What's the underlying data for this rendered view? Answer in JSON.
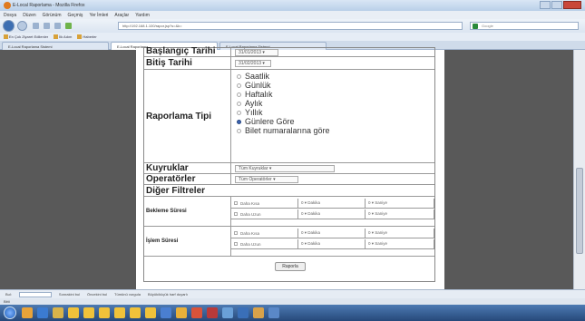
{
  "window": {
    "title": "E-Local Raporlama - Mozilla Firefox"
  },
  "menu": [
    "Dosya",
    "Düzen",
    "Görünüm",
    "Geçmiş",
    "Yer İmleri",
    "Araçlar",
    "Yardım"
  ],
  "nav": {
    "url": "http://192.168.1.100/rapor.jsp?s=&k=",
    "search_placeholder": "Google"
  },
  "bookmarks": [
    "En Çok Ziyaret Edilenler",
    "İlk Adım",
    "Haberler"
  ],
  "tabs": [
    "E-Local Raporlama Sistemi",
    "E-Local Raporlama",
    "E-Local Raporlama Sistemi"
  ],
  "form": {
    "baslangic_label": "Başlangıç Tarihi",
    "baslangic_value": "31/01/2013 ▾",
    "bitis_label": "Bitiş Tarihi",
    "bitis_value": "31/02/2013 ▾",
    "raporlama_label": "Raporlama Tipi",
    "raporlama_options": [
      "Saatlik",
      "Günlük",
      "Haftalık",
      "Aylık",
      "Yıllık",
      "Günlere Göre",
      "Bilet numaralarına göre"
    ],
    "raporlama_selected": 5,
    "kuyruklar_label": "Kuyruklar",
    "kuyruklar_value": "Tüm Kuyruklar                    ▾",
    "operatorler_label": "Operatörler",
    "operatorler_value": "Tüm Operatörler  ▾",
    "diger_label": "Diğer Filtreler",
    "bekleme_label": "Bekleme Süresi",
    "islem_label": "İşlem Süresi",
    "filter_rows": [
      {
        "check": "Daha Kısa",
        "dk": "0  ▾ Dakika",
        "sn": "0  ▾ Saniye"
      },
      {
        "check": "Daha Uzun",
        "dk": "0  ▾ Dakika",
        "sn": "0  ▾ Saniye"
      },
      {
        "check": "Daha Kısa",
        "dk": "0  ▾ Dakika",
        "sn": "0  ▾ Saniye"
      },
      {
        "check": "Daha Uzun",
        "dk": "0  ▾ Dakika",
        "sn": "0  ▾ Saniye"
      }
    ],
    "submit_label": "Raporla"
  },
  "findbar": {
    "label": "Bul:",
    "next": "Sonrakini bul",
    "prev": "Öncekini bul",
    "highlight": "Tümünü vurgula",
    "match": "Büyük/küçük harf duyarlı"
  },
  "status": "Bitti"
}
